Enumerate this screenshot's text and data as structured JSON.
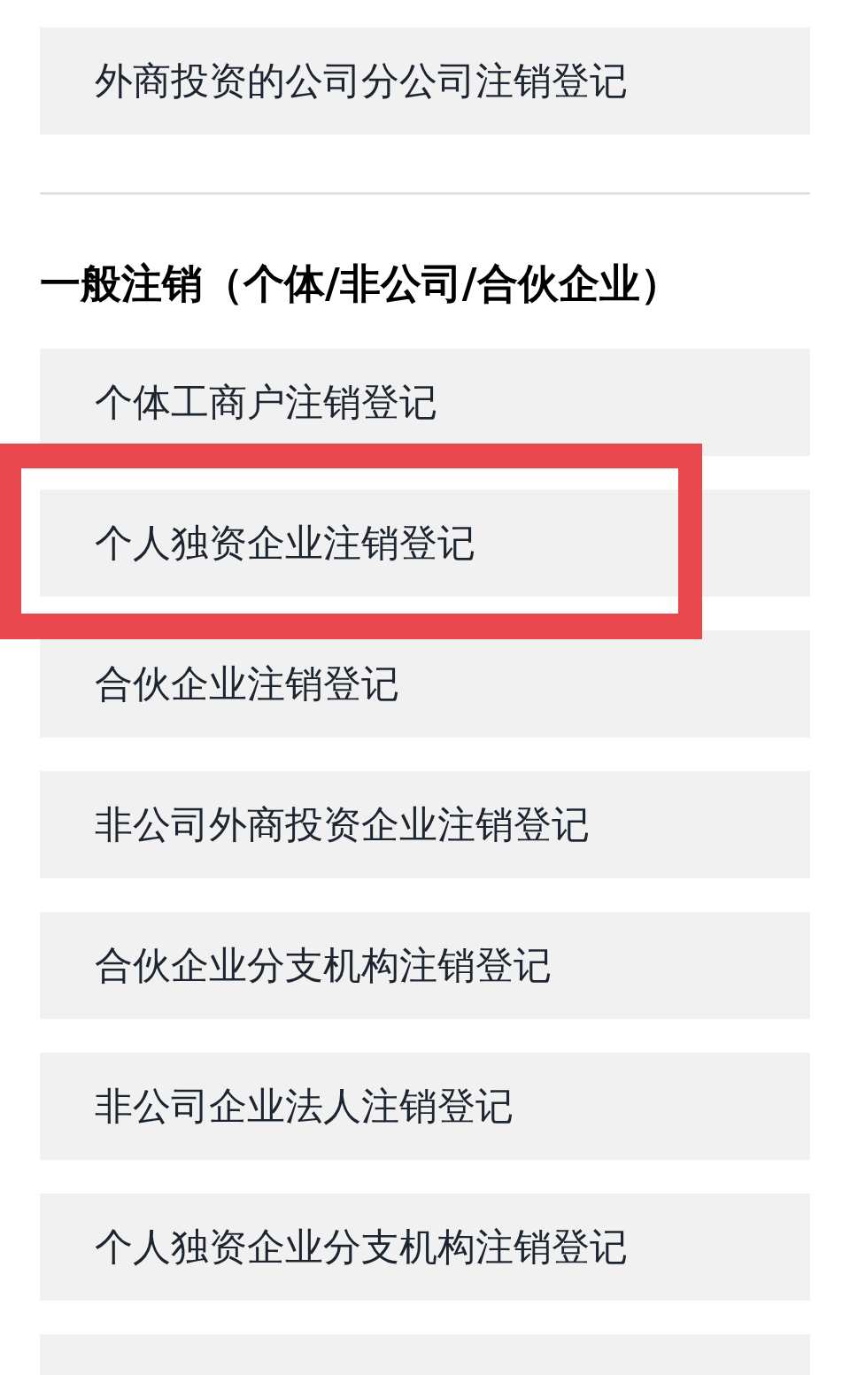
{
  "sections": [
    {
      "items": [
        {
          "label": "外商投资的公司分公司注销登记",
          "highlighted": false
        }
      ]
    },
    {
      "heading": "一般注销（个体/非公司/合伙企业）",
      "items": [
        {
          "label": "个体工商户注销登记",
          "highlighted": false
        },
        {
          "label": "个人独资企业注销登记",
          "highlighted": true
        },
        {
          "label": "合伙企业注销登记",
          "highlighted": false
        },
        {
          "label": "非公司外商投资企业注销登记",
          "highlighted": false
        },
        {
          "label": "合伙企业分支机构注销登记",
          "highlighted": false
        },
        {
          "label": "非公司企业法人注销登记",
          "highlighted": false
        },
        {
          "label": "个人独资企业分支机构注销登记",
          "highlighted": false
        },
        {
          "highlighted": false
        }
      ]
    }
  ]
}
